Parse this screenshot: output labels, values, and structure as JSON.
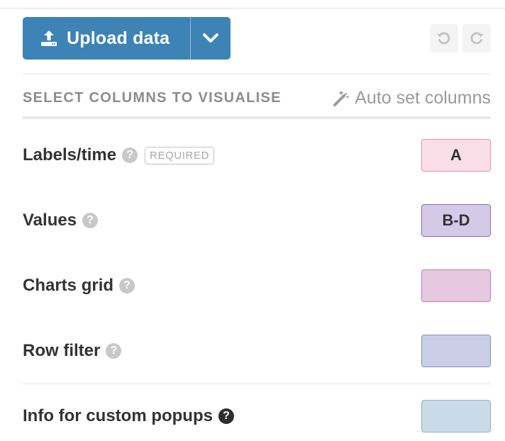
{
  "toolbar": {
    "upload_label": "Upload data",
    "upload_icon": "upload-icon",
    "dropdown_icon": "chevron-down-icon",
    "undo_icon": "undo-icon",
    "redo_icon": "redo-icon"
  },
  "section": {
    "title": "SELECT COLUMNS TO VISUALISE",
    "auto_set_label": "Auto set columns",
    "auto_set_icon": "magic-wand-icon"
  },
  "rows": [
    {
      "label": "Labels/time",
      "help": "?",
      "badge": "REQUIRED",
      "value": "A",
      "fill": "#fbdfe8",
      "border": "#e58fab"
    },
    {
      "label": "Values",
      "help": "?",
      "value": "B-D",
      "fill": "#d5c9e8",
      "border": "#8e6cc0"
    },
    {
      "label": "Charts grid",
      "help": "?",
      "value": "",
      "fill": "#e6c8df",
      "border": "#c07db2"
    },
    {
      "label": "Row filter",
      "help": "?",
      "value": "",
      "fill": "#cbcde6",
      "border": "#8890c6"
    },
    {
      "label": "Info for custom popups",
      "help": "?",
      "value": "",
      "fill": "#c9dbe6",
      "border": "#8fb0c6"
    }
  ],
  "colors": {
    "accent": "#3d83b6"
  }
}
